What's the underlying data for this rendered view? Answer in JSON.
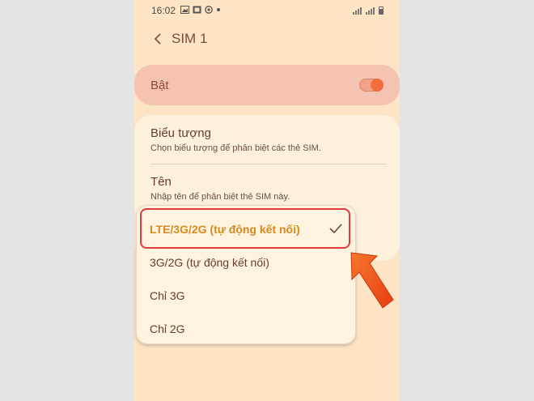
{
  "status_bar": {
    "time": "16:02",
    "icons": [
      "image-icon",
      "gallery-icon",
      "at-icon",
      "dot-icon"
    ]
  },
  "header": {
    "back_icon": "chevron-left-icon",
    "title": "SIM 1"
  },
  "toggle": {
    "label": "Bật",
    "on": true
  },
  "settings": [
    {
      "title": "Biểu tượng",
      "subtitle": "Chọn biểu tượng để phân biệt các thẻ SIM."
    },
    {
      "title": "Tên",
      "subtitle": "Nhập tên để phân biệt thẻ SIM này."
    }
  ],
  "network_mode_options": [
    {
      "label": "LTE/3G/2G (tự động kết nối)",
      "selected": true
    },
    {
      "label": "3G/2G (tự động kết nối)",
      "selected": false
    },
    {
      "label": "Chỉ 3G",
      "selected": false
    },
    {
      "label": "Chỉ 2G",
      "selected": false
    }
  ],
  "colors": {
    "screen_bg": "#fde4c4",
    "accent": "#d88a1f",
    "highlight": "#e23a3a",
    "arrow": "#f05a1c"
  }
}
